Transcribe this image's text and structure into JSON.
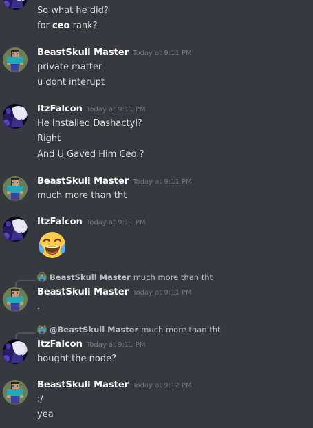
{
  "messages": {
    "m0": {
      "lines": [
        "So what he did?",
        "for ",
        "ceo",
        " rank?"
      ]
    },
    "m1": {
      "author": "BeastSkull Master",
      "timestamp": "Today at 9:11 PM",
      "lines": [
        "private matter",
        "u dont interupt"
      ]
    },
    "m2": {
      "author": "ItzFalcon",
      "timestamp": "Today at 9:11 PM",
      "lines": [
        "He Installed Dashactyl?",
        "Right",
        "And U Gaved Him Ceo ?"
      ]
    },
    "m3": {
      "author": "BeastSkull Master",
      "timestamp": "Today at 9:11 PM",
      "lines": [
        "much more than tht"
      ]
    },
    "m4": {
      "author": "ItzFalcon",
      "timestamp": "Today at 9:11 PM",
      "emoji": "joy-emoji"
    },
    "m5": {
      "reply_to": {
        "author": "BeastSkull Master",
        "text": "much more than tht"
      },
      "author": "BeastSkull Master",
      "timestamp": "Today at 9:11 PM",
      "lines": [
        "."
      ]
    },
    "m6": {
      "reply_to": {
        "author": "@BeastSkull Master",
        "text": "much more than tht"
      },
      "author": "ItzFalcon",
      "timestamp": "Today at 9:11 PM",
      "lines": [
        "bought the node?"
      ]
    },
    "m7": {
      "author": "BeastSkull Master",
      "timestamp": "Today at 9:12 PM",
      "lines": [
        ":/",
        "yea"
      ]
    }
  },
  "colors": {
    "background": "#36393f",
    "username": "#ffffff",
    "message_text": "#dcddde",
    "timestamp": "#72767d",
    "reply_spine": "#4f545c"
  },
  "icons": {
    "beastskull_avatar": "minecraft-skin-avatar",
    "falcon_avatar": "anime-character-avatar",
    "emoji": "face-with-tears-of-joy"
  }
}
